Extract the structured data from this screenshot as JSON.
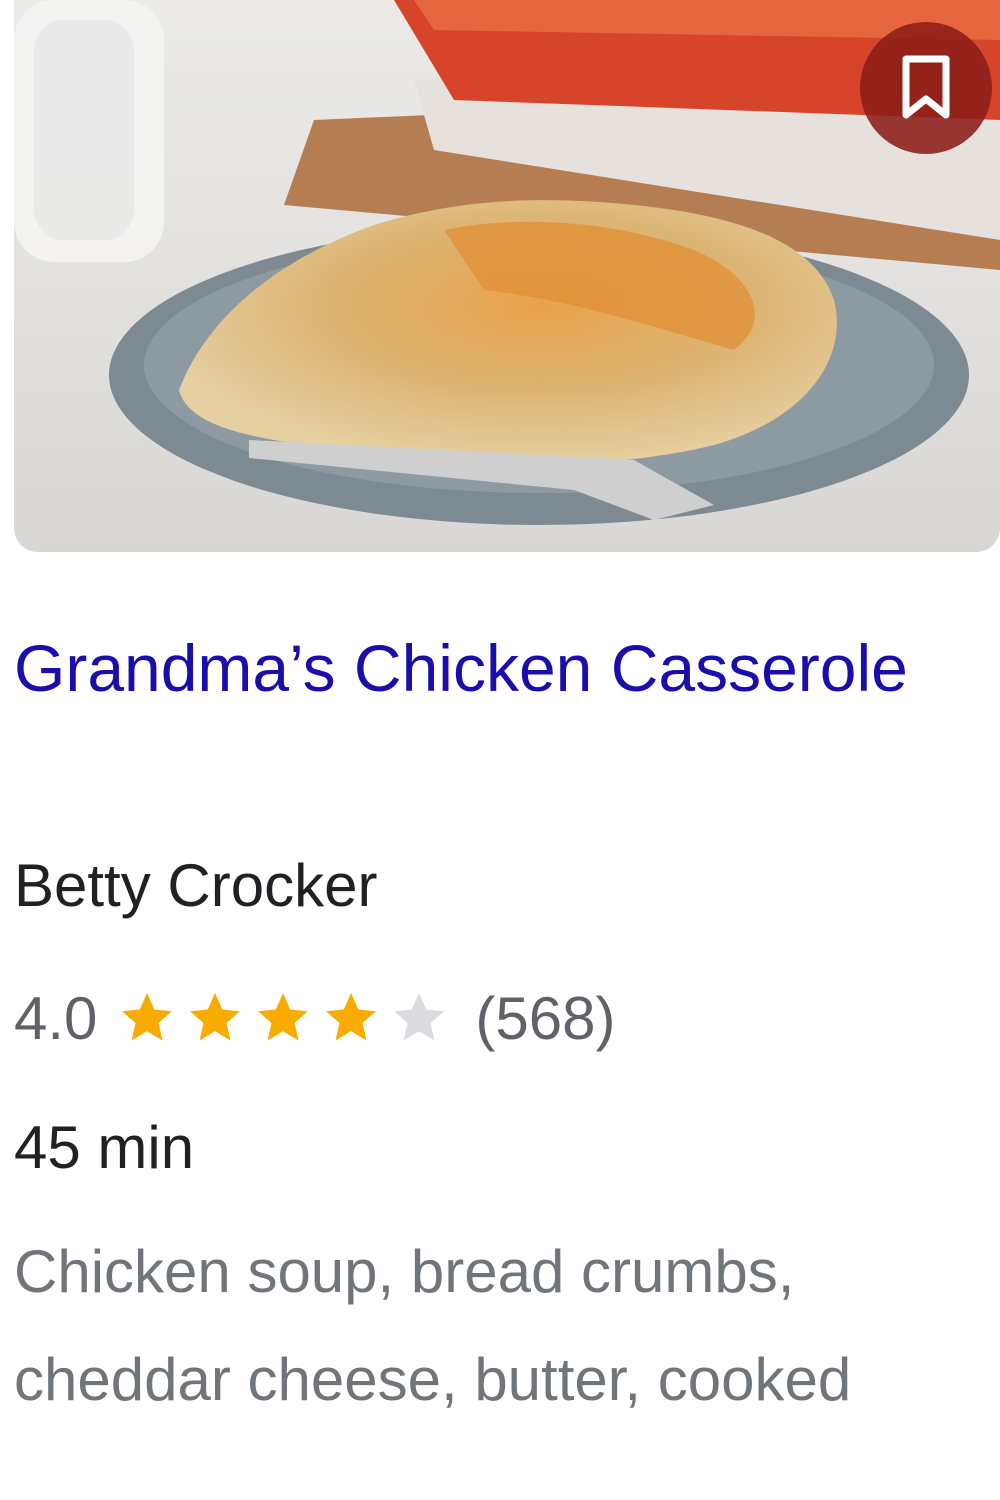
{
  "recipe": {
    "title": "Grandma’s Chicken Casserole",
    "source": "Betty Crocker",
    "rating_text": "4.0",
    "rating_value": 4.0,
    "rating_max": 5,
    "review_count": "(568)",
    "time": "45 min",
    "ingredients": "Chicken soup, bread crumbs, cheddar cheese, butter, cooked",
    "image_icon": "casserole-photo",
    "save_icon": "bookmark-icon"
  },
  "colors": {
    "title_link": "#1a0dab",
    "star_filled": "#f9ab00",
    "star_empty": "#dadce0",
    "save_button_bg": "#8c1e18"
  }
}
